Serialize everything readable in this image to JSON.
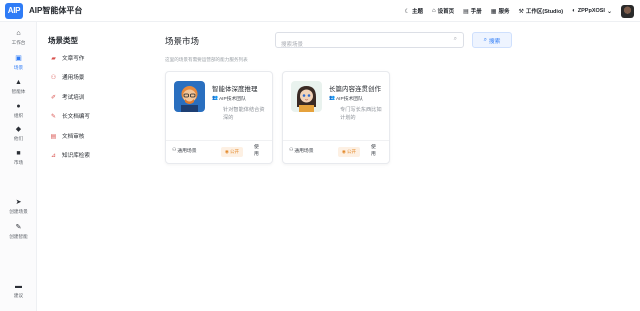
{
  "header": {
    "logo": "AIP",
    "brand": "AIP智能体平台",
    "actions": [
      {
        "icon": "moon-icon",
        "glyph": "☾",
        "label": "主题"
      },
      {
        "icon": "home-icon",
        "glyph": "⌂",
        "label": "设首页"
      },
      {
        "icon": "book-icon",
        "glyph": "▤",
        "label": "手册"
      },
      {
        "icon": "service-icon",
        "glyph": "▦",
        "label": "服务"
      },
      {
        "icon": "wrench-icon",
        "glyph": "⚒",
        "label": "工作区(Studio)"
      },
      {
        "icon": "shield-icon",
        "glyph": "◐",
        "label": "ZPPpXOSI"
      }
    ],
    "dropdown_glyph": "⌄"
  },
  "sidebar": {
    "items": [
      {
        "icon": "home-icon",
        "glyph": "⌂",
        "label": "工作台"
      },
      {
        "icon": "scene-icon",
        "glyph": "▣",
        "label": "场景"
      },
      {
        "icon": "agent-icon",
        "glyph": "▲",
        "label": "智能体"
      },
      {
        "icon": "team-icon",
        "glyph": "●",
        "label": "组织"
      },
      {
        "icon": "chat-icon",
        "glyph": "◆",
        "label": "他们"
      },
      {
        "icon": "market-icon",
        "glyph": "■",
        "label": "市场"
      },
      {
        "icon": "send-icon",
        "glyph": "➤",
        "label": "创建场景"
      },
      {
        "icon": "pen-icon",
        "glyph": "✎",
        "label": "创建智能"
      },
      {
        "icon": "feedback-icon",
        "glyph": "▬",
        "label": "建议"
      }
    ]
  },
  "categories": {
    "title": "场景类型",
    "items": [
      {
        "icon": "doc-write-icon",
        "glyph": "▰",
        "label": "文章写作"
      },
      {
        "icon": "general-icon",
        "glyph": "⚇",
        "label": "通用场景"
      },
      {
        "icon": "exam-icon",
        "glyph": "✐",
        "label": "考试培训"
      },
      {
        "icon": "longdoc-icon",
        "glyph": "✎",
        "label": "长文档编写"
      },
      {
        "icon": "review-icon",
        "glyph": "▤",
        "label": "文档审核"
      },
      {
        "icon": "search-kb-icon",
        "glyph": "⊿",
        "label": "知识库检索"
      }
    ]
  },
  "main": {
    "title": "场景市场",
    "search_placeholder": "搜索场景",
    "search_button": "搜索",
    "hint": "这里的场景有需要运营部的能力服务列表",
    "cards": [
      {
        "title": "智能体深度推理",
        "team": "AIP技术团队",
        "desc": "针对智能体结合资深的",
        "tag": "通用场景",
        "badge": "公开",
        "use": "使用"
      },
      {
        "title": "长篇内容连贯创作",
        "team": "AIP技术团队",
        "desc": "专门写长东西比如计划的",
        "tag": "通用场景",
        "badge": "公开",
        "use": "使用"
      }
    ]
  }
}
